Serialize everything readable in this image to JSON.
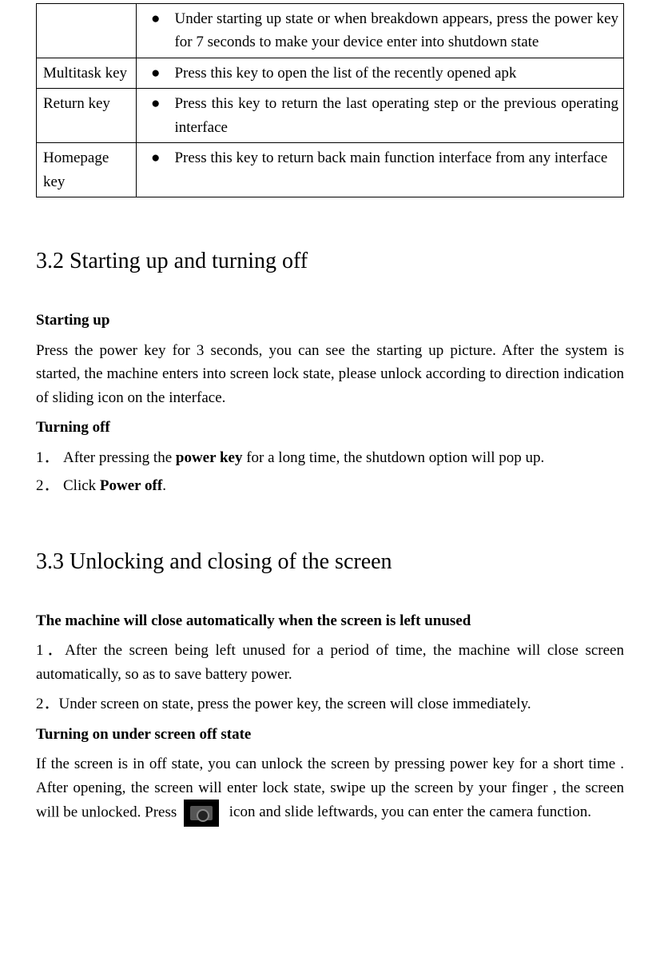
{
  "table": {
    "rows": [
      {
        "key": "",
        "desc": "Under starting up state or when breakdown appears, press the power key for 7 seconds to make your device enter into shutdown state"
      },
      {
        "key": "Multitask key",
        "desc": "Press this key to open the list of the recently opened apk"
      },
      {
        "key": "Return key",
        "desc": "Press this key to return the last operating step or the previous operating interface"
      },
      {
        "key": "Homepage key",
        "desc": "Press this key to return back main function interface from any interface"
      }
    ]
  },
  "s32": {
    "title": "3.2 Starting up and turning off",
    "h1": "Starting up",
    "p1": "Press the power key for 3 seconds, you can see the starting up picture. After the system is started, the machine enters into screen lock state, please unlock according to direction indication of sliding icon on the interface.",
    "h2": "Turning off",
    "n1": "1．",
    "t1a": "After pressing the ",
    "t1b": "power key",
    "t1c": " for a long time, the shutdown option will pop up.",
    "n2": "2．",
    "t2a": "Click ",
    "t2b": "Power off",
    "t2c": "."
  },
  "s33": {
    "title": "3.3 Unlocking and closing of the screen",
    "h1": "The machine will close automatically when the screen is left unused",
    "n1": "1．",
    "p1": "After the screen being left unused for a period of time, the machine will close screen automatically, so as to save battery power.",
    "n2": "2．",
    "p2": "Under screen on state, press the power key, the screen will close immediately.",
    "h2": "Turning on under screen off state",
    "p3a": "If the screen is in off state, you can unlock the screen by pressing power key for a short time . After opening, the screen will enter lock state, swipe up the screen by your finger , the screen will be unlocked. Press",
    "p3b": "icon and slide leftwards, you can enter the camera function."
  }
}
